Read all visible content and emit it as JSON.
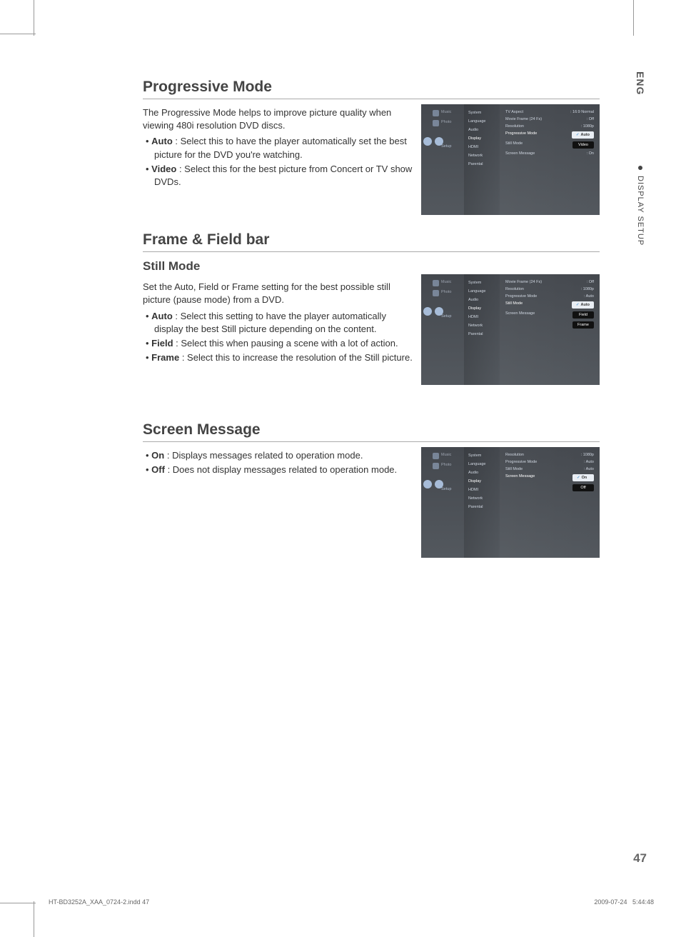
{
  "side": {
    "lang": "ENG",
    "tab": "DISPLAY SETUP"
  },
  "page_number": "47",
  "footer": {
    "slug": "HT-BD3252A_XAA_0724-2.indd   47",
    "date": "2009-07-24",
    "time": "5:44:48"
  },
  "s1": {
    "title": "Progressive Mode",
    "intro": "The Progressive Mode helps to improve picture quality when viewing 480i resolution DVD discs.",
    "opt1_label": "Auto",
    "opt1_text": " : Select this to have the player automatically set the best picture for the DVD you're watching.",
    "opt2_label": "Video",
    "opt2_text": " : Select this for the best picture from Concert or TV show DVDs."
  },
  "s2": {
    "title": "Frame & Field bar",
    "subtitle": "Still Mode",
    "intro": "Set the Auto, Field or Frame setting for the best possible still picture (pause mode) from a DVD.",
    "opt1_label": "Auto",
    "opt1_text": " : Select this setting to have the player automatically display the best Still picture depending on the content.",
    "opt2_label": "Field",
    "opt2_text": "  : Select this when pausing a scene with a lot of action.",
    "opt3_label": "Frame",
    "opt3_text": " : Select this to increase the resolution of the Still picture."
  },
  "s3": {
    "title": "Screen Message",
    "opt1_label": "On",
    "opt1_text": " : Displays messages related to operation mode.",
    "opt2_label": "Off",
    "opt2_text": " : Does not display messages related to operation mode."
  },
  "shot_left": {
    "music": "Music",
    "photo": "Photo",
    "setup": "Setup"
  },
  "shot_mid": {
    "system": "System",
    "language": "Language",
    "audio": "Audio",
    "display": "Display",
    "hdmi": "HDMI",
    "network": "Network",
    "parental": "Parental"
  },
  "shot1": {
    "r1l": "TV Aspect",
    "r1v": ": 16:9 Normal",
    "r2l": "Movie Frame (24 Fs)",
    "r2v": ": Off",
    "r3l": "Resolution",
    "r3v": ": 1080p",
    "r4l": "Progressive Mode",
    "r4v": "Auto",
    "r5l": "Still Mode",
    "r5v": "Video",
    "r6l": "Screen Message",
    "r6v": ": On"
  },
  "shot2": {
    "r1l": "Movie Frame (24 Fs)",
    "r1v": ": Off",
    "r2l": "Resolution",
    "r2v": ": 1080p",
    "r3l": "Progressive Mode",
    "r3v": ": Auto",
    "r4l": "Still Mode",
    "r4v": "Auto",
    "r5l": "Screen Message",
    "r5v1": "Field",
    "r5v2": "Frame"
  },
  "shot3": {
    "r1l": "Resolution",
    "r1v": ": 1080p",
    "r2l": "Progressive Mode",
    "r2v": ": Auto",
    "r3l": "Still Mode",
    "r3v": ": Auto",
    "r4l": "Screen Message",
    "r4v": "On",
    "r5v": "Off"
  }
}
